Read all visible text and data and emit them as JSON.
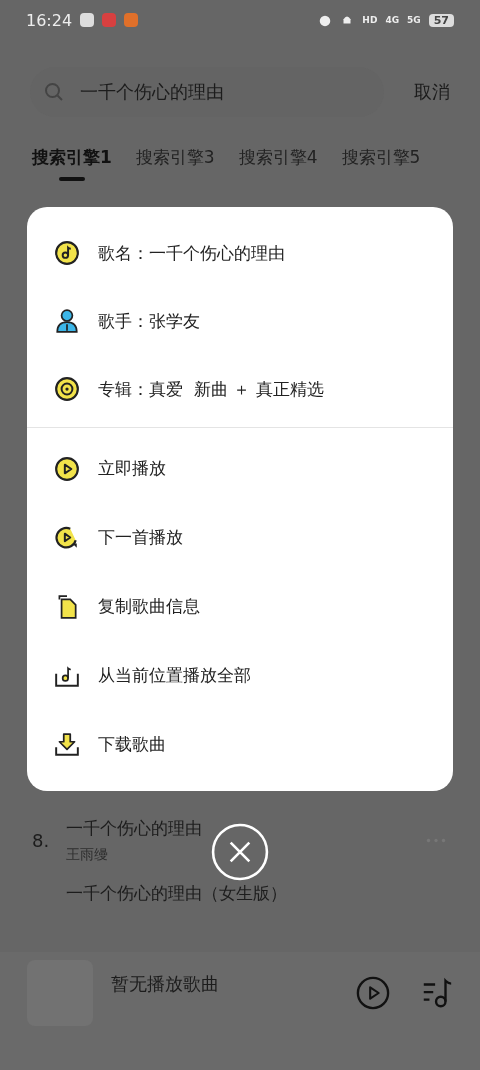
{
  "status_bar": {
    "time": "16:24",
    "network_labels": [
      "HD",
      "4G",
      "5G"
    ],
    "battery": "57"
  },
  "search": {
    "value": "一千个伤心的理由",
    "cancel": "取消"
  },
  "tabs": [
    {
      "label": "搜索引擎1",
      "selected": true
    },
    {
      "label": "搜索引擎3",
      "selected": false
    },
    {
      "label": "搜索引擎4",
      "selected": false
    },
    {
      "label": "搜索引擎5",
      "selected": false
    }
  ],
  "results": [
    {
      "index": "8.",
      "title": "一千个伤心的理由",
      "artist": "王雨缦"
    },
    {
      "title": "一千个伤心的理由（女生版）"
    }
  ],
  "sheet": {
    "info": [
      {
        "kind": "song",
        "label": "歌名：一千个伤心的理由"
      },
      {
        "kind": "artist",
        "label": "歌手：张学友"
      },
      {
        "kind": "album",
        "label": "专辑：真爱  新曲 ＋ 真正精选"
      }
    ],
    "actions": [
      {
        "kind": "play",
        "label": "立即播放"
      },
      {
        "kind": "next",
        "label": "下一首播放"
      },
      {
        "kind": "copy",
        "label": "复制歌曲信息"
      },
      {
        "kind": "play_all",
        "label": "从当前位置播放全部"
      },
      {
        "kind": "download",
        "label": "下载歌曲"
      }
    ]
  },
  "player": {
    "text": "暂无播放歌曲"
  }
}
